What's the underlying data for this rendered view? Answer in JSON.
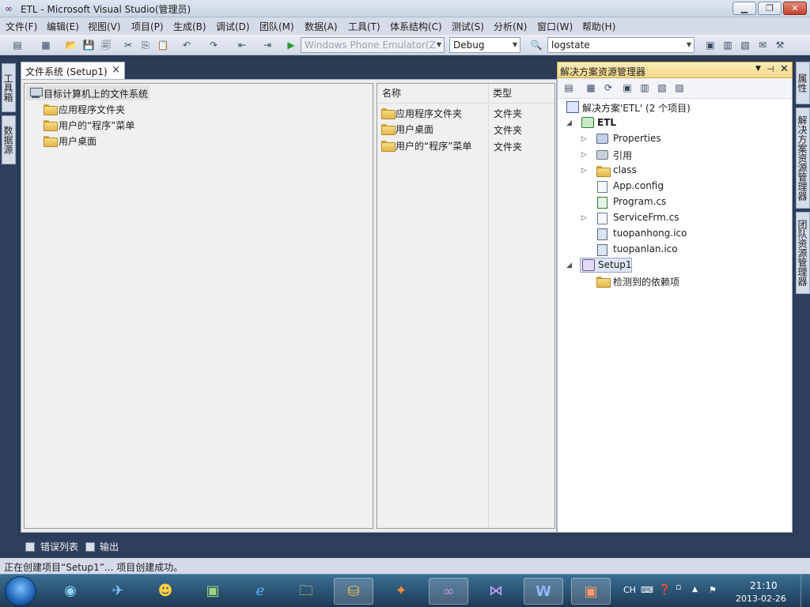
{
  "window": {
    "title": "ETL - Microsoft Visual Studio(管理员)"
  },
  "menu": [
    "文件(F)",
    "编辑(E)",
    "视图(V)",
    "项目(P)",
    "生成(B)",
    "调试(D)",
    "团队(M)",
    "数据(A)",
    "工具(T)",
    "体系结构(C)",
    "测试(S)",
    "分析(N)",
    "窗口(W)",
    "帮助(H)"
  ],
  "toolbar": {
    "target_device": "Windows Phone Emulator(Z",
    "config": "Debug",
    "find_text": "logstate"
  },
  "left_strip": {
    "toolbox": "工具箱",
    "datasource": "数据源"
  },
  "right_strip": {
    "properties": "属性",
    "solution_explorer": "解决方案资源管理器",
    "team_explorer": "团队资源管理器"
  },
  "doc_tab": {
    "label": "文件系统 (Setup1)",
    "close": "×"
  },
  "fs_tree": {
    "root": "目标计算机上的文件系统",
    "children": [
      "应用程序文件夹",
      "用户的“程序”菜单",
      "用户桌面"
    ]
  },
  "fs_list": {
    "headers": {
      "name": "名称",
      "type": "类型"
    },
    "rows": [
      {
        "name": "应用程序文件夹",
        "type": "文件夹"
      },
      {
        "name": "用户桌面",
        "type": "文件夹"
      },
      {
        "name": "用户的“程序”菜单",
        "type": "文件夹"
      }
    ]
  },
  "solution_explorer": {
    "title": "解决方案资源管理器",
    "solution": "解决方案'ETL' (2 个项目)",
    "project1": {
      "name": "ETL",
      "items": [
        "Properties",
        "引用",
        "class",
        "App.config",
        "Program.cs",
        "ServiceFrm.cs",
        "tuopanhong.ico",
        "tuopanlan.ico"
      ]
    },
    "project2": {
      "name": "Setup1",
      "items": [
        "检测到的依赖项"
      ]
    }
  },
  "bottom_tabs": {
    "error_list": "错误列表",
    "output": "输出"
  },
  "status": {
    "text": "正在创建项目“Setup1”... 项目创建成功。"
  },
  "tray": {
    "lang": "CH",
    "time": "21:10",
    "date": "2013-02-26"
  }
}
